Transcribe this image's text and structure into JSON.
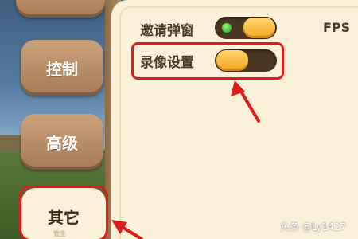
{
  "tabs": {
    "top_label": "",
    "control_label": "控制",
    "advanced_label": "高级",
    "other_label": "其它",
    "other_sublabel": "管生"
  },
  "settings": {
    "invite_popup_label": "邀请弹窗",
    "invite_popup_on": true,
    "record_settings_label": "录像设置",
    "record_settings_on": false,
    "fps_label": "FPS"
  },
  "annotations": {
    "highlight_color": "#e01b1b"
  },
  "watermark": "头条 @Ly1427",
  "colors": {
    "panel_bg": "#fbf1d8",
    "tab_brown": "#a77b55",
    "toggle_knob": "#f4a623",
    "toggle_track": "#4a3520",
    "indicator_on": "#1fa51a"
  }
}
